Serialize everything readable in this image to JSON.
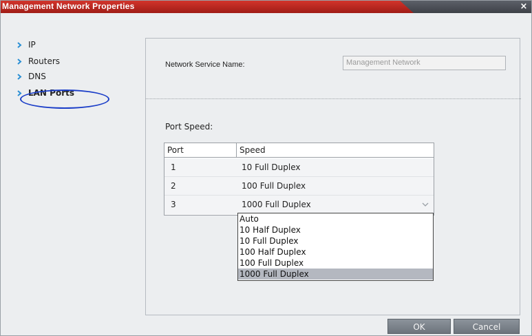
{
  "window": {
    "title": "Management Network Properties",
    "close_glyph": "×"
  },
  "sidebar": {
    "items": [
      {
        "label": "IP"
      },
      {
        "label": "Routers"
      },
      {
        "label": "DNS"
      },
      {
        "label": "LAN Ports",
        "active": true
      }
    ]
  },
  "main": {
    "service_name_label": "Network Service Name:",
    "service_name_value": "Management Network",
    "port_speed_label": "Port Speed:",
    "table": {
      "headers": [
        "Port",
        "Speed"
      ],
      "rows": [
        {
          "port": "1",
          "speed": "10 Full Duplex"
        },
        {
          "port": "2",
          "speed": "100 Full Duplex"
        },
        {
          "port": "3",
          "speed": "1000 Full Duplex"
        }
      ]
    },
    "dropdown": {
      "options": [
        "Auto",
        "10 Half Duplex",
        "10 Full Duplex",
        "100 Half Duplex",
        "100 Full Duplex",
        "1000 Full Duplex"
      ],
      "selected": "1000 Full Duplex"
    }
  },
  "footer": {
    "ok_label": "OK",
    "cancel_label": "Cancel"
  },
  "colors": {
    "title_red": "#c1271f",
    "highlight_ellipse": "#1a3dc8",
    "nav_arrow": "#2a8fd4",
    "button_gray": "#7d848c"
  }
}
